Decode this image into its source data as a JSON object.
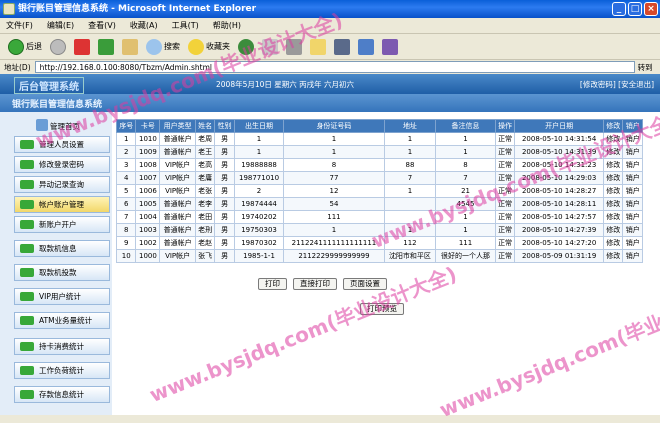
{
  "window": {
    "title": "银行账目管理信息系统 - Microsoft Internet Explorer",
    "controls": [
      "_",
      "□",
      "×"
    ]
  },
  "menu": [
    "文件(F)",
    "编辑(E)",
    "查看(V)",
    "收藏(A)",
    "工具(T)",
    "帮助(H)"
  ],
  "toolbar": {
    "back": "后退",
    "search": "搜索",
    "favorites": "收藏夹"
  },
  "address": {
    "label": "地址(D)",
    "url": "http://192.168.0.100:8080/Tbzm/Admin.shtml",
    "go": "转到"
  },
  "header": {
    "logo": "后台管理系统",
    "date": "2008年5月10日 星期六 丙戌年 六月初六",
    "links": "[修改密码] [安全退出]",
    "system_name": "银行账目管理信息系统"
  },
  "sidebar": {
    "title": "管理首页",
    "items": [
      "管理人员设置",
      "修改登录密码",
      "异动记录查询",
      "帐户账户管理",
      "新账户开户",
      "取款机信息",
      "取款机投款",
      "VIP用户统计",
      "ATM业务量统计",
      "持卡消费统计",
      "工作负荷统计",
      "存款信息统计"
    ]
  },
  "table": {
    "headers": [
      "序号",
      "卡号",
      "用户类型",
      "姓名",
      "性别",
      "出生日期",
      "身份证号码",
      "地址",
      "备注信息",
      "操作",
      "开户日期",
      "修改",
      "销户"
    ],
    "rows": [
      [
        "1",
        "1010",
        "普通帐户",
        "老周",
        "男",
        "1",
        "1",
        "1",
        "1",
        "正常",
        "2008-05-10 14:31:54",
        "修改",
        "销户"
      ],
      [
        "2",
        "1009",
        "普通帐户",
        "老王",
        "男",
        "1",
        "1",
        "1",
        "1",
        "正常",
        "2008-05-10 14:31:39",
        "修改",
        "销户"
      ],
      [
        "3",
        "1008",
        "VIP帐户",
        "老高",
        "男",
        "19888888",
        "8",
        "88",
        "8",
        "正常",
        "2008-05-10 14:31:23",
        "修改",
        "销户"
      ],
      [
        "4",
        "1007",
        "VIP帐户",
        "老庸",
        "男",
        "198771010",
        "77",
        "7",
        "7",
        "正常",
        "2008-05-10 14:29:03",
        "修改",
        "销户"
      ],
      [
        "5",
        "1006",
        "VIP帐户",
        "老张",
        "男",
        "2",
        "12",
        "1",
        "21",
        "正常",
        "2008-05-10 14:28:27",
        "修改",
        "销户"
      ],
      [
        "6",
        "1005",
        "普通帐户",
        "老李",
        "男",
        "19874444",
        "54",
        "",
        "4545",
        "正常",
        "2008-05-10 14:28:11",
        "修改",
        "销户"
      ],
      [
        "7",
        "1004",
        "普通帐户",
        "老田",
        "男",
        "19740202",
        "111",
        "",
        "1",
        "正常",
        "2008-05-10 14:27:57",
        "修改",
        "销户"
      ],
      [
        "8",
        "1003",
        "普通帐户",
        "老刑",
        "男",
        "19750303",
        "1",
        "1",
        "1",
        "正常",
        "2008-05-10 14:27:39",
        "修改",
        "销户"
      ],
      [
        "9",
        "1002",
        "普通帐户",
        "老赵",
        "男",
        "19870302",
        "2112241111111111111",
        "112",
        "111",
        "正常",
        "2008-05-10 14:27:20",
        "修改",
        "销户"
      ],
      [
        "10",
        "1000",
        "VIP帐户",
        "张飞",
        "男",
        "1985-1-1",
        "2112229999999999",
        "沈阳市和平区",
        "很好的一个人那",
        "正常",
        "2008-05-09 01:31:19",
        "修改",
        "销户"
      ]
    ]
  },
  "buttons": {
    "print": "打印",
    "direct_print": "直接打印",
    "page_setup": "页面设置",
    "preview": "打印预览"
  },
  "watermark": "www.bysjdq.com(毕业设计大全)"
}
